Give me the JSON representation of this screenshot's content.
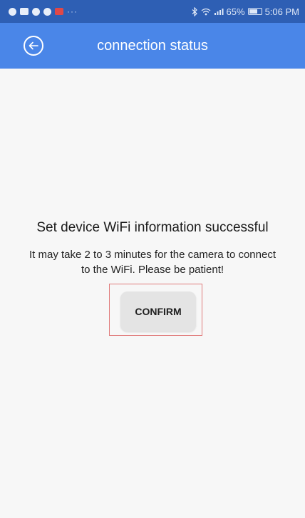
{
  "status_bar": {
    "overflow_indicator": "···",
    "battery_percent": "65%",
    "time": "5:06 PM"
  },
  "app_bar": {
    "title": "connection status",
    "back_icon": "back-arrow-circle-icon"
  },
  "main": {
    "headline": "Set device WiFi information successful",
    "message": "It may take 2 to 3 minutes for the camera to connect to the WiFi. Please be patient!",
    "confirm_label": "CONFIRM"
  },
  "colors": {
    "status_bar": "#2e5fb4",
    "app_bar": "#4a86e8",
    "highlight_border": "#e07b7b"
  }
}
